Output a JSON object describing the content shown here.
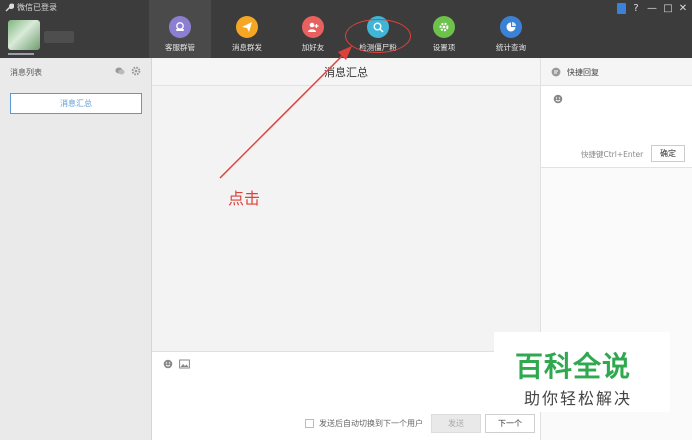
{
  "window": {
    "title": "微信已登录",
    "controls": [
      "?",
      "—",
      "□",
      "✕"
    ]
  },
  "nav": {
    "tabs": [
      {
        "label": "客服群管",
        "icon": "headset-icon",
        "color": "#8c7fd1",
        "active": true
      },
      {
        "label": "消息群发",
        "icon": "send-icon",
        "color": "#f5a623",
        "active": false
      },
      {
        "label": "加好友",
        "icon": "add-friend-icon",
        "color": "#e8615f",
        "active": false
      },
      {
        "label": "检测僵尸粉",
        "icon": "detect-icon",
        "color": "#3fb6d8",
        "active": false
      },
      {
        "label": "设置项",
        "icon": "settings-icon",
        "color": "#6cc24a",
        "active": false
      },
      {
        "label": "统计查询",
        "icon": "chart-pie-icon",
        "color": "#3b82d6",
        "active": false
      }
    ]
  },
  "left": {
    "header": "消息列表",
    "summary_button": "消息汇总"
  },
  "middle": {
    "title": "消息汇总",
    "auto_switch_label": "发送后自动切换到下一个用户",
    "send_button": "发送",
    "next_button": "下一个"
  },
  "right": {
    "title": "快捷回复",
    "shortcut_hint": "快捷键Ctrl+Enter",
    "confirm_button": "确定"
  },
  "annotation": {
    "click_label": "点击",
    "color": "#e0403a"
  },
  "watermark": {
    "title": "百科全说",
    "subtitle": "助你轻松解决"
  }
}
